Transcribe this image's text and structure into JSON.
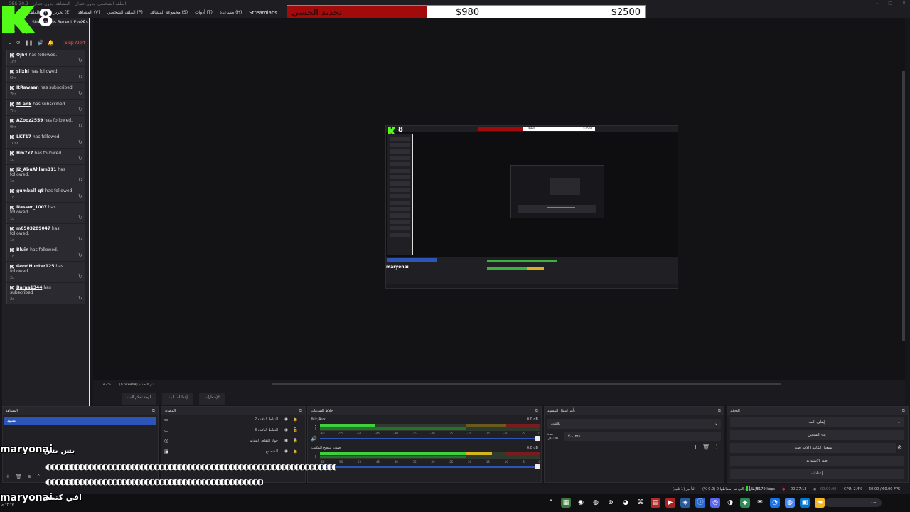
{
  "window": {
    "title": "OBS 30.2 - الملف الشخصي: بدون عنوان - المشاهد: بدون عنوان",
    "menu": [
      "الملف (F)",
      "تحرير (E)",
      "المشاهد (V)",
      "الملف الشخصي (P)",
      "مجموعة المشاهد (S)",
      "أدوات (T)",
      "مساعدة (H)"
    ],
    "streamlabs": "Streamlabs"
  },
  "logo": {
    "eight": "8",
    "color": "#53fc18"
  },
  "goal": {
    "title": "تحديد الجسي",
    "current": "$980",
    "target": "$2500",
    "progress": 0.392,
    "color": "#a10b0b"
  },
  "events_dock": {
    "title": "Streamlabs Recent Events",
    "skip_alert": "Skip Alert",
    "items": [
      {
        "user": "Ojh4",
        "action": "has followed.",
        "time": "1hr"
      },
      {
        "user": "slixhi",
        "action": "has followed.",
        "time": "5hr"
      },
      {
        "user": "ItRawaan",
        "action": "has subscribed",
        "time": "7hr",
        "sub": true
      },
      {
        "user": "M_ank",
        "action": "has subscribed",
        "time": "7hr",
        "sub": true
      },
      {
        "user": "AZooz2559",
        "action": "has followed.",
        "time": "9hr"
      },
      {
        "user": "LKT17",
        "action": "has followed.",
        "time": "10hr"
      },
      {
        "user": "Hm7x7",
        "action": "has followed.",
        "time": "1d"
      },
      {
        "user": "J2_AbuAhlam311",
        "action": "has followed.",
        "time": "1d"
      },
      {
        "user": "gumball_q8",
        "action": "has followed.",
        "time": "1d"
      },
      {
        "user": "Nasser_1007",
        "action": "has followed.",
        "time": "1d"
      },
      {
        "user": "m0503289047",
        "action": "has followed.",
        "time": "1d"
      },
      {
        "user": "Bluin",
        "action": "has followed.",
        "time": "1d"
      },
      {
        "user": "GoodHunter125",
        "action": "has followed.",
        "time": "2d"
      },
      {
        "user": "Baraa1344",
        "action": "has subscribed",
        "time": "2d",
        "sub": true
      }
    ]
  },
  "preview": {
    "zoom": "42%",
    "resolution": "(824x464) تم التحديد",
    "tabs": [
      "لوحة تحكم البث",
      "إعدادات البث",
      "الإشعارات"
    ],
    "mini_goal_current": "$980",
    "mini_goal_target": "$2500"
  },
  "scenes": {
    "title": "المشاهد",
    "items": [
      "مشهد"
    ]
  },
  "sources": {
    "title": "المصادر",
    "items": [
      {
        "name": "التقاط النافذة 2",
        "icon": "window-icon"
      },
      {
        "name": "التقاط النافذة 3",
        "icon": "window-icon"
      },
      {
        "name": "جهاز التقاط الفيديو",
        "icon": "camera-icon"
      },
      {
        "name": "المتصفح",
        "icon": "browser-icon"
      }
    ]
  },
  "mixer": {
    "title": "خلاط الصوتيات",
    "channels": [
      {
        "name": "Mic/Aux",
        "db": "0.0 dB",
        "level": 0.25
      },
      {
        "name": "صوت سطح المكتب",
        "db": "0.0 dB",
        "level": 0.78
      }
    ],
    "scale": [
      "-60",
      "-55",
      "-50",
      "-45",
      "-40",
      "-35",
      "-30",
      "-25",
      "-20",
      "-15",
      "-10",
      "-5",
      "0"
    ]
  },
  "transitions": {
    "title": "تأثير انتقال المشهد",
    "type": "تلاشي",
    "duration_label": "مدة الانتقال",
    "duration": "٣٠٠ ms"
  },
  "controls": {
    "title": "التحكم",
    "buttons": [
      "إيقاف البث",
      "بدء التسجيل",
      "تشغيل الكاميرا الافتراضية",
      "طور الاستوديو",
      "إعدادات"
    ]
  },
  "status": {
    "dropped": "الإطارات التي تم إسقاطها 0 (0.0 %)",
    "delay": "التأخير (1 ثانية)",
    "bitrate": "8179 kbps",
    "stream_time": "00:27:13",
    "rec_time": "00:00:00",
    "cpu": "CPU: 2.4%",
    "fps": "60.00 / 60.00 FPS"
  },
  "taskbar": {
    "search": "بحث",
    "clock": "١٢:١٧ م"
  },
  "chat": {
    "name1": "maryonai",
    "msg1": "بس بس",
    "emoji1": "◐◐◐◐◐◐◐◐◐◐◐◐◐◐◐◐◐◐◐◐◐◐◐◐◐◐◐◐◐◐◐◐◐◐◐◐◐◐◐◐◐◐◐◐◐◐◐◐◐◐◐◐◐◐◐◐◐◐◐◐◐◐◐◐◐◐◐◐◐◐◐◐◐◐◐◐◐◐◐◐◐",
    "emoji2": "◐◐◐◐◐◐◐◐◐◐◐◐◐◐◐◐◐◐◐◐◐◐◐◐◐◐◐◐◐◐◐◐◐◐◐◐◐◐◐◐◐◐◐◐◐◐◐◐◐◐◐◐◐◐◐◐◐◐◐◐",
    "name2": "maryonai",
    "msg2": "افي كتمه"
  }
}
